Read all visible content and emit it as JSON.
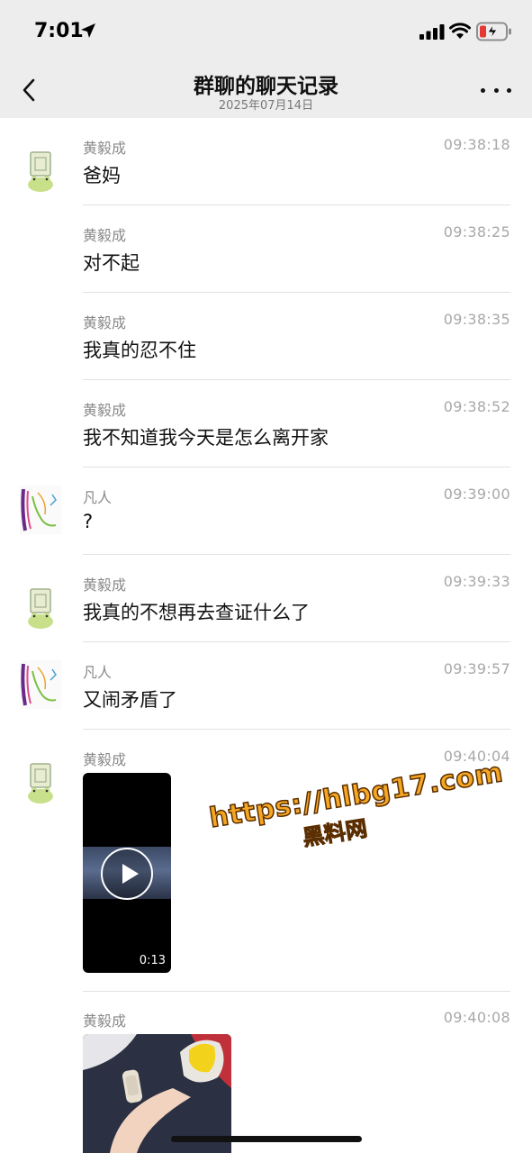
{
  "status": {
    "time": "7:01"
  },
  "nav": {
    "title": "群聊的聊天记录",
    "date": "2025年07月14日"
  },
  "messages": [
    {
      "sender": "黄毅成",
      "time": "09:38:18",
      "text": "爸妈",
      "avatar": "frog-avatar"
    },
    {
      "sender": "黄毅成",
      "time": "09:38:25",
      "text": "对不起"
    },
    {
      "sender": "黄毅成",
      "time": "09:38:35",
      "text": "我真的忍不住"
    },
    {
      "sender": "黄毅成",
      "time": "09:38:52",
      "text": "我不知道我今天是怎么离开家"
    },
    {
      "sender": "凡人",
      "time": "09:39:00",
      "text": "?",
      "avatar": "art-avatar"
    },
    {
      "sender": "黄毅成",
      "time": "09:39:33",
      "text": "我真的不想再去查证什么了",
      "avatar": "frog-avatar"
    },
    {
      "sender": "凡人",
      "time": "09:39:57",
      "text": "又闹矛盾了",
      "avatar": "art-avatar"
    },
    {
      "sender": "黄毅成",
      "time": "09:40:04",
      "video_duration": "0:13",
      "avatar": "frog-avatar"
    },
    {
      "sender": "黄毅成",
      "time": "09:40:08",
      "photo": true
    }
  ],
  "watermark": {
    "url": "https://hlbg17.com",
    "name": "黑料网"
  }
}
